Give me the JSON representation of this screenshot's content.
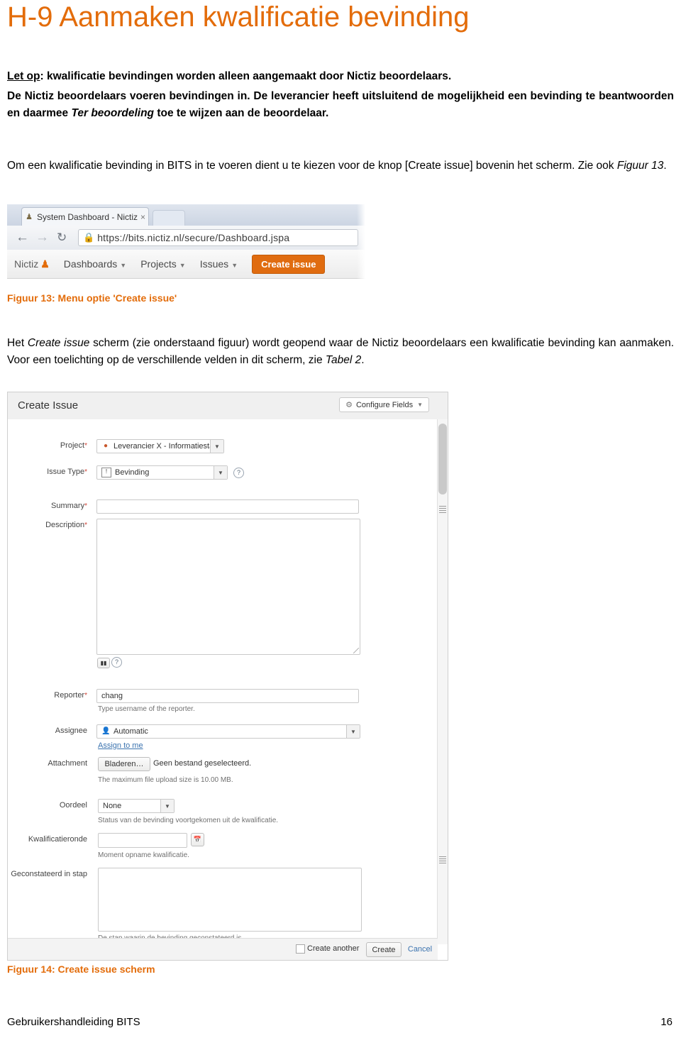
{
  "document": {
    "title": "H-9 Aanmaken kwalificatie bevinding",
    "note_label": "Let op",
    "note_text": ": kwalificatie bevindingen worden alleen aangemaakt door Nictiz beoordelaars.",
    "paragraph2_a": "De Nictiz beoordelaars voeren bevindingen in.",
    "paragraph2_b": "De leverancier  heeft uitsluitend de mogelijkheid een bevinding te beantwoorden en daarmee ",
    "paragraph2_italic": "Ter beoordeling",
    "paragraph2_c": " toe te wijzen aan de beoordelaar.",
    "paragraph3": "Om een kwalificatie bevinding in BITS in te voeren dient u te kiezen voor de knop [Create issue] bovenin het scherm. Zie ook ",
    "paragraph3_italic": "Figuur 13",
    "paragraph3_end": ".",
    "caption13": "Figuur 13: Menu optie 'Create issue'",
    "paragraph4_a": "Het ",
    "paragraph4_italic1": "Create issue",
    "paragraph4_b": " scherm (zie onderstaand figuur) wordt geopend waar de Nictiz beoordelaars een kwalificatie bevinding kan aanmaken. Voor een toelichting op de verschillende velden in dit scherm, zie ",
    "paragraph4_italic2": "Tabel 2",
    "paragraph4_c": ".",
    "caption14": "Figuur 14: Create issue scherm",
    "footer_left": "Gebruikershandleiding BITS",
    "footer_page": "16",
    "accent_color": "#E36C0A"
  },
  "figure13": {
    "tab_title": "System Dashboard - Nictiz",
    "tab_favicon_icon": "person-icon",
    "tab_close_icon": "close-icon",
    "new_tab_icon": "new-tab-icon",
    "back_icon": "arrow-left-icon",
    "forward_icon": "arrow-right-icon",
    "reload_icon": "reload-icon",
    "lock_icon": "lock-icon",
    "url_scheme": "https://",
    "url_domain": "bits.nictiz.nl",
    "url_path": "/secure/Dashboard.jspa",
    "brand": "Nictiz",
    "brand_icon": "nictiz-logo-icon",
    "menu": [
      {
        "label": "Dashboards",
        "caret": "▼"
      },
      {
        "label": "Projects",
        "caret": "▼"
      },
      {
        "label": "Issues",
        "caret": "▼"
      }
    ],
    "create_button": "Create issue"
  },
  "figure14": {
    "dialog_title": "Create Issue",
    "configure_fields_button": "Configure Fields",
    "configure_gear_icon": "gear-icon",
    "configure_caret_icon": "chevron-down-icon",
    "fields": [
      {
        "label": "Project",
        "required": true,
        "value": "Leverancier X - Informatiesta…",
        "icon": "project-avatar-icon",
        "control": "select"
      },
      {
        "label": "Issue Type",
        "required": true,
        "value": "Bevinding",
        "icon": "issue-type-icon",
        "control": "select",
        "help_icon": "help-icon"
      },
      {
        "label": "Summary",
        "required": true,
        "value": "",
        "control": "text"
      },
      {
        "label": "Description",
        "required": true,
        "value": "",
        "control": "textarea",
        "toolbar_icon": "text-format-icon",
        "help_icon": "help-icon"
      },
      {
        "label": "Reporter",
        "required": true,
        "value": "chang",
        "control": "text",
        "hint": "Type username of the reporter."
      },
      {
        "label": "Assignee",
        "required": false,
        "value": "Automatic",
        "icon": "user-icon",
        "control": "select",
        "link": "Assign to me"
      },
      {
        "label": "Attachment",
        "required": false,
        "button": "Bladeren…",
        "value": "Geen bestand geselecteerd.",
        "control": "file",
        "hint": "The maximum file upload size is 10.00 MB."
      },
      {
        "label": "Oordeel",
        "required": false,
        "value": "None",
        "control": "select",
        "hint": "Status van de bevinding voortgekomen uit de kwalificatie."
      },
      {
        "label": "Kwalificatieronde",
        "required": false,
        "value": "",
        "control": "date",
        "icon": "calendar-icon",
        "hint": "Moment opname kwalificatie."
      },
      {
        "label": "Geconstateerd in stap",
        "required": false,
        "value": "",
        "control": "textarea",
        "hint": "De stap waarin de bevinding geconstateerd is."
      }
    ],
    "footer": {
      "create_another_label": "Create another",
      "create_button": "Create",
      "cancel_button": "Cancel",
      "checkbox_checked": false
    }
  }
}
